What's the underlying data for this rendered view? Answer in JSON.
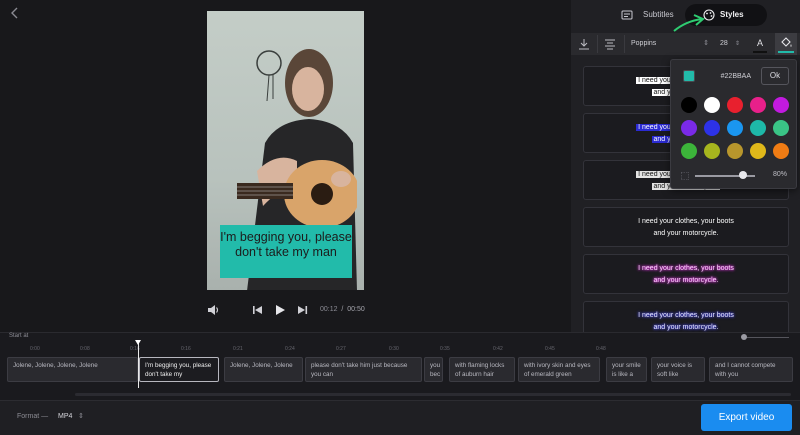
{
  "preview": {
    "subtitle": "I'm begging you, please don't take my man",
    "time_current": "00:12",
    "time_separator": "/",
    "time_total": "00:50"
  },
  "tabs": [
    {
      "label": "Subtitles",
      "icon": "subtitles-icon"
    },
    {
      "label": "Styles",
      "icon": "palette-icon",
      "active": true
    }
  ],
  "toolbar": {
    "font": "Poppins",
    "size": "28",
    "text_color_label": "A"
  },
  "style_cards": [
    {
      "lines": [
        "I need your clothes, your boots",
        "and your motorcycle."
      ]
    },
    {
      "lines": [
        "I need your clothes, your boots",
        "and your motorcycle."
      ]
    },
    {
      "lines": [
        "I need your clothes, your boots",
        "and your motorcycle."
      ]
    },
    {
      "lines": [
        "I need your clothes, your boots",
        "and your motorcycle."
      ]
    },
    {
      "lines": [
        "I need your clothes, your boots",
        "and your motorcycle."
      ]
    },
    {
      "lines": [
        "I need your clothes, your boots",
        "and your motorcycle."
      ]
    }
  ],
  "color_picker": {
    "hex": "#22BBAA",
    "ok_label": "Ok",
    "swatches": [
      "#000000",
      "#ffffff",
      "#e8202e",
      "#e8208a",
      "#c21ae0",
      "#7a2ae8",
      "#2d32e8",
      "#1a96f0",
      "#1eb8a8",
      "#3ac486",
      "#3cb43a",
      "#a6b51e",
      "#b8962c",
      "#e0b81a",
      "#f07c14"
    ],
    "opacity": "80%",
    "opacity_fraction": 0.8
  },
  "timeline": {
    "start_label": "Start at",
    "ticks": [
      "0:00",
      "0:08",
      "0:16",
      "0:16",
      "0:21",
      "0:24",
      "0:27",
      "0:30",
      "0:35",
      "0:42",
      "0:45",
      "0:48"
    ],
    "clips": [
      {
        "text": "Jolene, Jolene, Jolene, Jolene"
      },
      {
        "text": "I'm begging you, please don't take my",
        "active": true
      },
      {
        "text": "Jolene, Jolene, Jolene"
      },
      {
        "text": "please don't take him just because you can"
      },
      {
        "text": "you bec"
      },
      {
        "text": "with flaming locks of auburn hair"
      },
      {
        "text": "with ivory skin and eyes of emerald green"
      },
      {
        "text": "your smile is like a"
      },
      {
        "text": "your voice is soft like"
      },
      {
        "text": "and I cannot compete with you"
      }
    ]
  },
  "bottom": {
    "format_label": "Format —",
    "format_value": "MP4",
    "export_label": "Export video"
  }
}
